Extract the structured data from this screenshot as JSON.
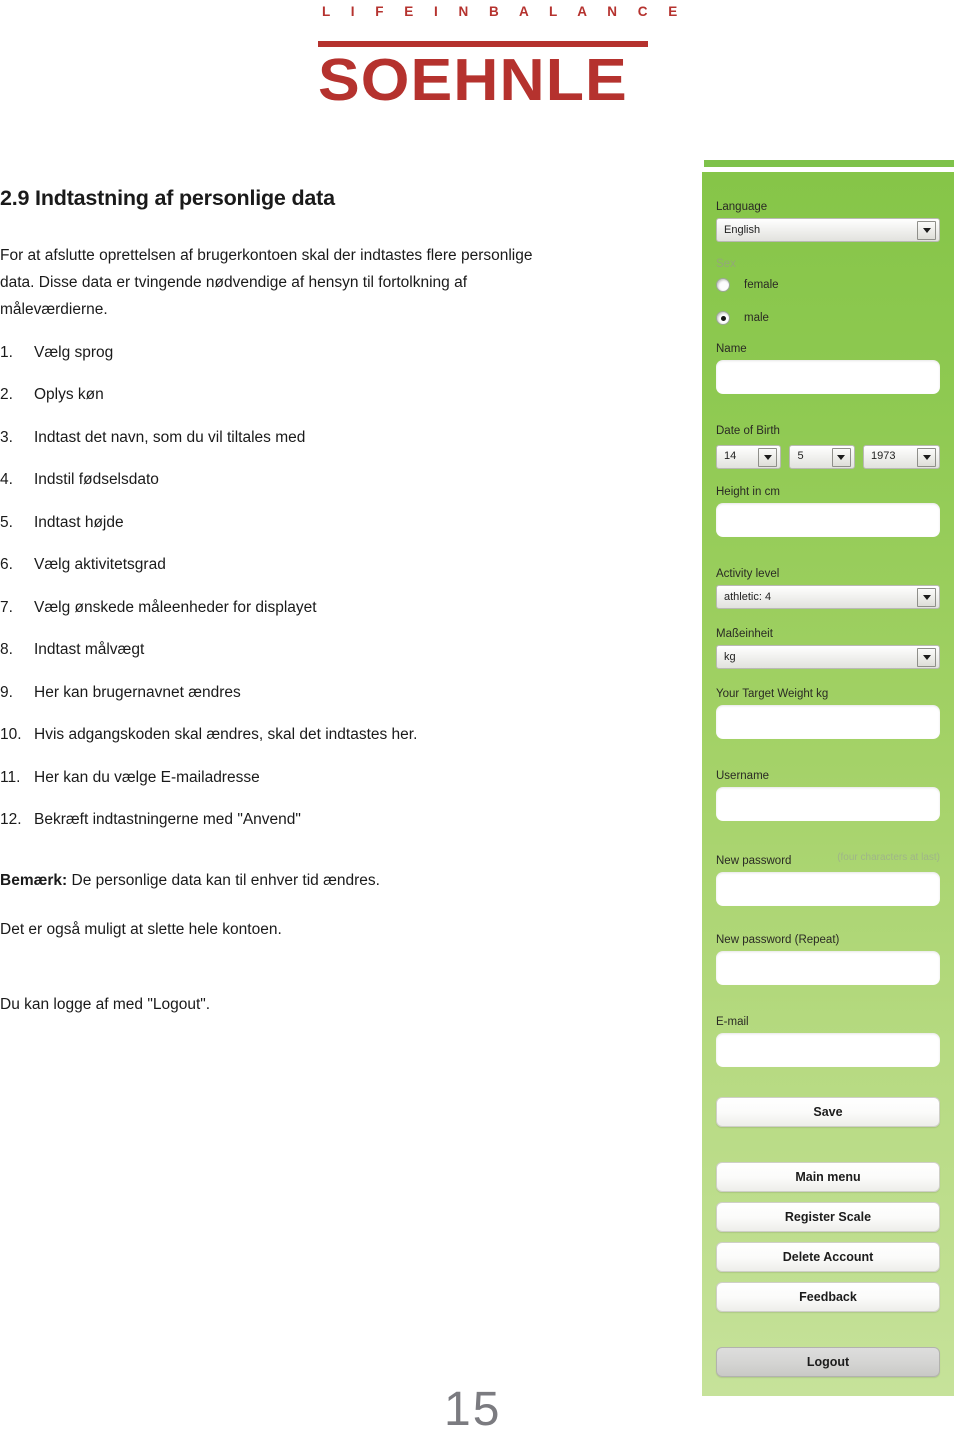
{
  "brand": {
    "tagline": "L I F E   I N   B A L A N C E",
    "wordmark": "SOEHNLE",
    "color": "#b5322e"
  },
  "document": {
    "title": "2.9 Indtastning af personlige data",
    "intro": "For at afslutte oprettelsen af brugerkontoen skal der indtastes flere personlige data. Disse data er tvingende nødvendige af hensyn til fortolkning af måleværdierne.",
    "steps": [
      {
        "num": "1.",
        "text": "Vælg sprog"
      },
      {
        "num": "2.",
        "text": "Oplys køn"
      },
      {
        "num": "3.",
        "text": "Indtast det navn, som du vil tiltales med"
      },
      {
        "num": "4.",
        "text": "Indstil fødselsdato"
      },
      {
        "num": "5.",
        "text": "Indtast højde"
      },
      {
        "num": "6.",
        "text": "Vælg aktivitetsgrad"
      },
      {
        "num": "7.",
        "text": "Vælg ønskede måleenheder for displayet"
      },
      {
        "num": "8.",
        "text": "Indtast målvægt"
      },
      {
        "num": "9.",
        "text": "Her kan brugernavnet ændres"
      },
      {
        "num": "10.",
        "text": "Hvis adgangskoden skal ændres, skal det indtastes her."
      },
      {
        "num": "11.",
        "text": "Her kan du vælge E-mailadresse"
      },
      {
        "num": "12.",
        "text": "Bekræft indtastningerne med \"Anvend\""
      }
    ],
    "note_bold": "Bemærk:",
    "note_rest": " De personlige data kan til enhver tid ændres.",
    "note_delete": "Det er også muligt at slette hele kontoen.",
    "note_logout": "Du kan logge af med \"Logout\".",
    "page_number": "15"
  },
  "app": {
    "panel_color": "#8ec951",
    "language": {
      "label": "Language",
      "value": "English"
    },
    "sex": {
      "label": "Sex",
      "female": "female",
      "male": "male",
      "selected": "male"
    },
    "name": {
      "label": "Name",
      "value": ""
    },
    "dob": {
      "label": "Date of Birth",
      "day": "14",
      "month": "5",
      "year": "1973"
    },
    "height": {
      "label": "Height in cm",
      "value": ""
    },
    "activity": {
      "label": "Activity level",
      "value": "athletic: 4"
    },
    "unit": {
      "label": "Maßeinheit",
      "value": "kg"
    },
    "target_weight": {
      "label": "Your Target Weight kg",
      "value": ""
    },
    "username": {
      "label": "Username",
      "value": ""
    },
    "new_password": {
      "label": "New password",
      "hint": "(four characters at last)",
      "value": ""
    },
    "new_password_repeat": {
      "label": "New password (Repeat)",
      "value": ""
    },
    "email": {
      "label": "E-mail",
      "value": ""
    },
    "buttons": {
      "save": "Save",
      "main_menu": "Main menu",
      "register_scale": "Register Scale",
      "delete_account": "Delete Account",
      "feedback": "Feedback",
      "logout": "Logout"
    }
  }
}
